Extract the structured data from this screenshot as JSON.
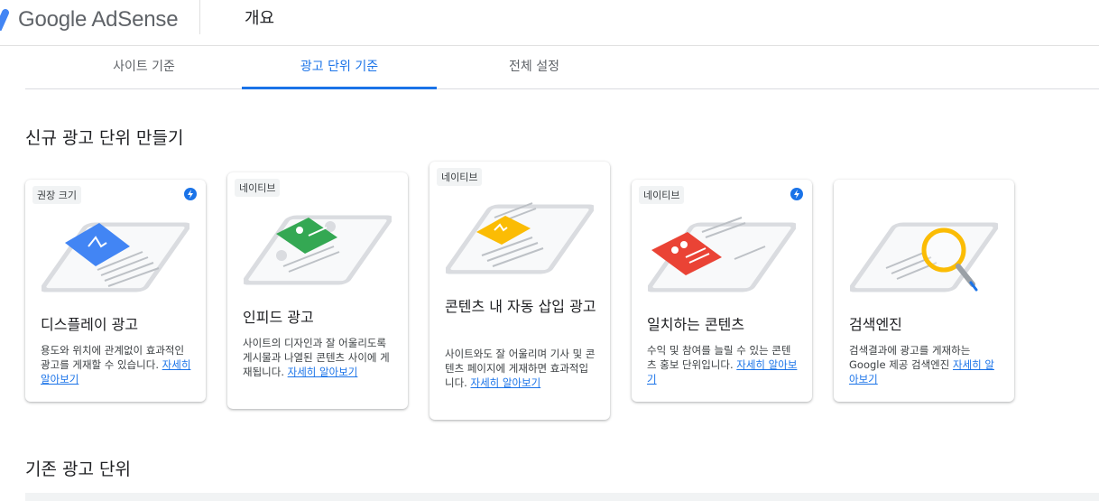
{
  "header": {
    "logo_text": "Google AdSense",
    "page_title": "개요"
  },
  "tabs": [
    {
      "label": "사이트 기준"
    },
    {
      "label": "광고 단위 기준"
    },
    {
      "label": "전체 설정"
    }
  ],
  "new_section": {
    "title": "신규 광고 단위 만들기"
  },
  "cards": [
    {
      "badge": "권장 크기",
      "title": "디스플레이 광고",
      "desc": "용도와 위치에 관계없이 효과적인 광고를 게재할 수 있습니다.",
      "link": "자세히 알아보기"
    },
    {
      "badge": "네이티브",
      "title": "인피드 광고",
      "desc": "사이트의 디자인과 잘 어울리도록 게시물과 나열된 콘텐츠 사이에 게재됩니다.",
      "link": "자세히 알아보기"
    },
    {
      "badge": "네이티브",
      "title": "콘텐츠 내 자동 삽입 광고",
      "desc": "사이트와도 잘 어울리며 기사 및 콘텐츠 페이지에 게재하면 효과적입니다.",
      "link": "자세히 알아보기"
    },
    {
      "badge": "네이티브",
      "title": "일치하는 콘텐츠",
      "desc": "수익 및 참여를 늘릴 수 있는 콘텐츠 홍보 단위입니다.",
      "link": "자세히 알아보기"
    },
    {
      "title": "검색엔진",
      "desc": "검색결과에 광고를 게재하는 Google 제공 검색엔진",
      "link": "자세히 알아보기"
    }
  ],
  "existing_section": {
    "title": "기존 광고 단위"
  },
  "colors": {
    "accent": "#1a73e8",
    "display": "#4285f4",
    "infeed": "#34a853",
    "inarticle": "#fbbc04",
    "matched": "#ea4335",
    "search": "#fbbc04"
  }
}
